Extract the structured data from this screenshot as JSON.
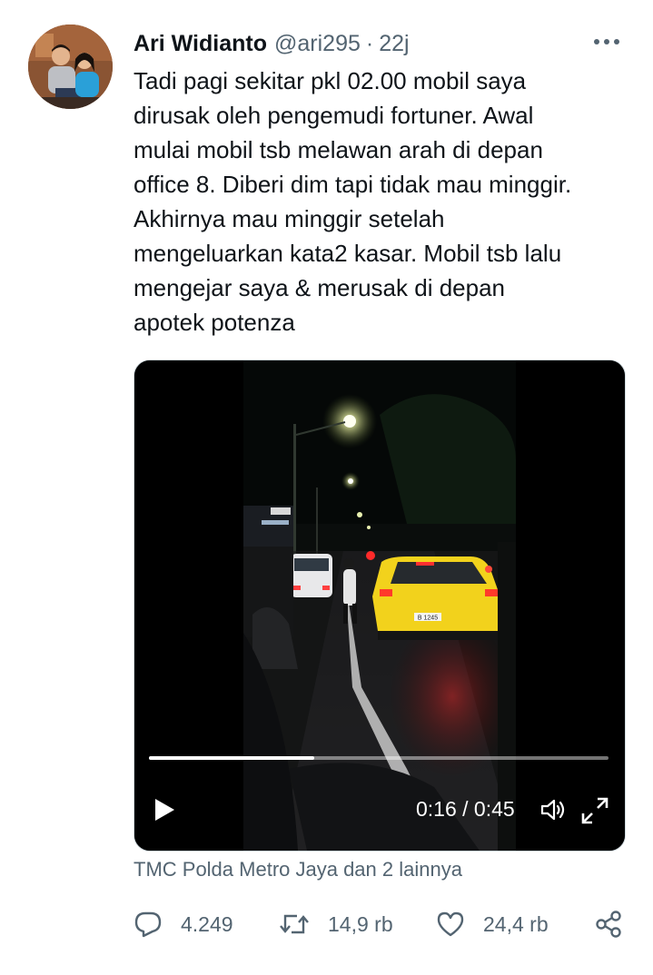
{
  "tweet": {
    "author_name": "Ari Widianto",
    "handle": "@ari295",
    "separator": "·",
    "time": "22j",
    "text": "Tadi pagi sekitar pkl 02.00 mobil saya\ndirusak oleh pengemudi fortuner. Awal\nmulai mobil tsb melawan arah di depan\noffice 8. Diberi dim tapi tidak mau minggir.\nAkhirnya mau minggir setelah\nmengeluarkan kata2 kasar. Mobil tsb lalu\nmengejar saya & merusak di depan\napotek potenza"
  },
  "video": {
    "time_display": "0:16 / 0:45",
    "progress_fraction": 0.36,
    "plate_text": "B 1245"
  },
  "tagged_users": "TMC Polda Metro Jaya dan 2 lainnya",
  "actions": {
    "replies": "4.249",
    "retweets": "14,9 rb",
    "likes": "24,4 rb"
  },
  "icons": {
    "more": "more-horizontal-icon",
    "play": "play-icon",
    "volume": "volume-icon",
    "fullscreen": "fullscreen-icon",
    "reply": "reply-icon",
    "retweet": "retweet-icon",
    "like": "heart-icon",
    "share": "share-icon"
  },
  "colors": {
    "text_primary": "#0f1419",
    "text_secondary": "#536471",
    "car_yellow": "#f2d21c"
  }
}
